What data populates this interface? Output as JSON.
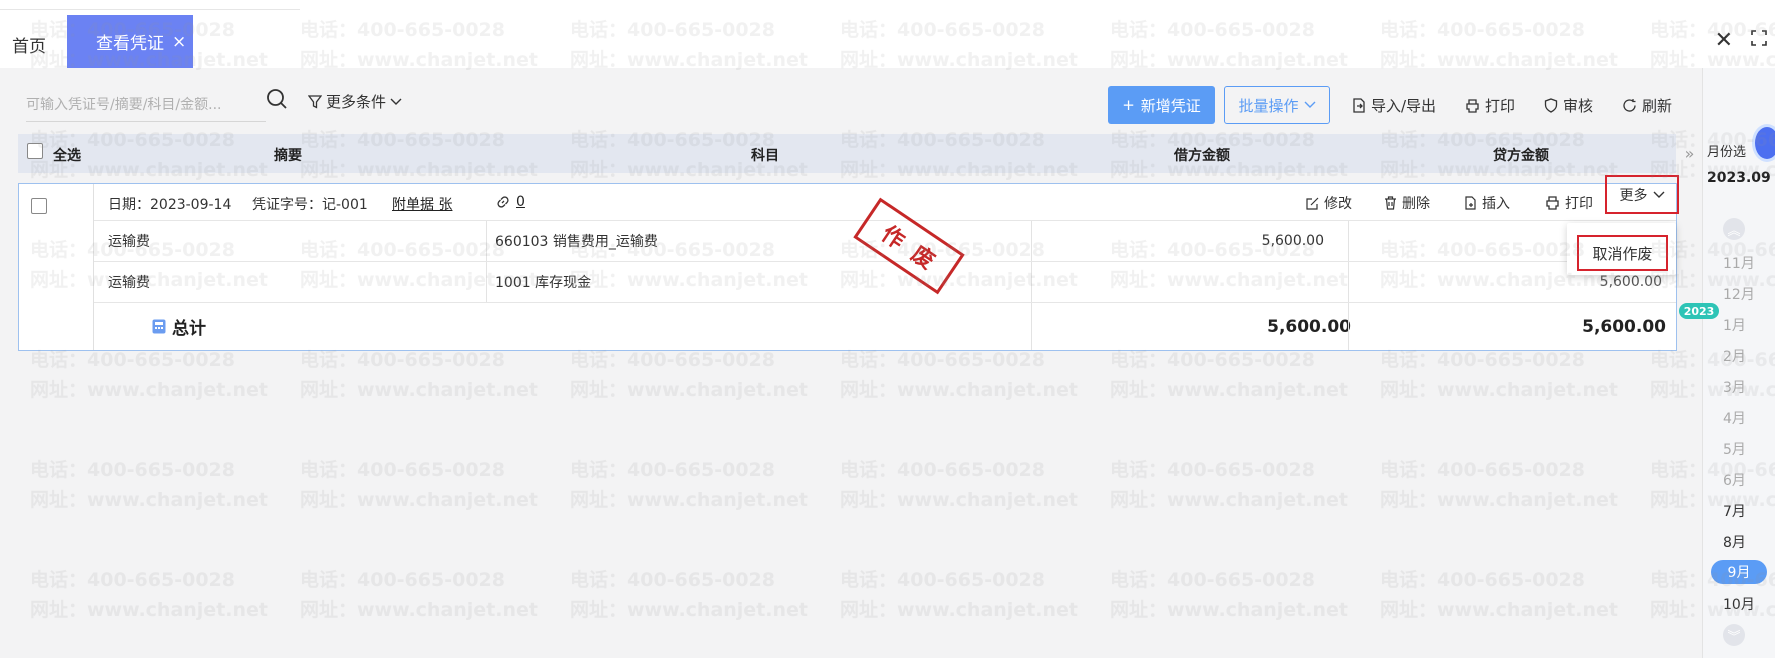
{
  "tabs": {
    "home_label": "首页",
    "active_label": "查看凭证",
    "active_close": "×"
  },
  "toolbar": {
    "search_placeholder": "可输入凭证号/摘要/科目/金额...",
    "more_filter_label": "更多条件",
    "new_voucher_label": "新增凭证",
    "batch_label": "批量操作",
    "import_export_label": "导入/导出",
    "print_label": "打印",
    "audit_label": "审核",
    "refresh_label": "刷新"
  },
  "table": {
    "select_all_label": "全选",
    "columns": [
      "摘要",
      "科目",
      "借方金额",
      "贷方金额"
    ]
  },
  "voucher": {
    "date_label": "日期：2023-09-14",
    "number_label": "凭证字号：记-001",
    "attachment_label": "附单据 张",
    "link_count": "0",
    "actions": {
      "edit": "修改",
      "delete": "删除",
      "insert": "插入",
      "print": "打印",
      "more": "更多"
    },
    "stamp_text": "作废",
    "entries": [
      {
        "summary": "运输费",
        "account": "660103 销售费用_运输费",
        "debit": "5,600.00",
        "credit": ""
      },
      {
        "summary": "运输费",
        "account": "1001 库存现金",
        "debit": "",
        "credit": "5,600.00"
      }
    ],
    "total_label": "总计",
    "total_debit": "5,600.00",
    "total_credit": "5,600.00"
  },
  "dropdown": {
    "cancel_void_label": "取消作废"
  },
  "month_panel": {
    "header": "月份选",
    "current": "2023.09",
    "prev_year_months": [
      "11月",
      "12月"
    ],
    "year_badge": "2023",
    "months": [
      "1月",
      "2月",
      "3月",
      "4月",
      "5月",
      "6月",
      "7月",
      "8月",
      "9月",
      "10月"
    ],
    "selected": "9月"
  },
  "watermark": {
    "phone": "电话：400-665-0028",
    "site": "网址：www.chanjet.net"
  },
  "colors": {
    "accent": "#6b82f3",
    "primary_button": "#5b9cf5",
    "highlight_border": "#d6232d",
    "stamp": "#c62828",
    "year_badge": "#2ec4b6"
  }
}
